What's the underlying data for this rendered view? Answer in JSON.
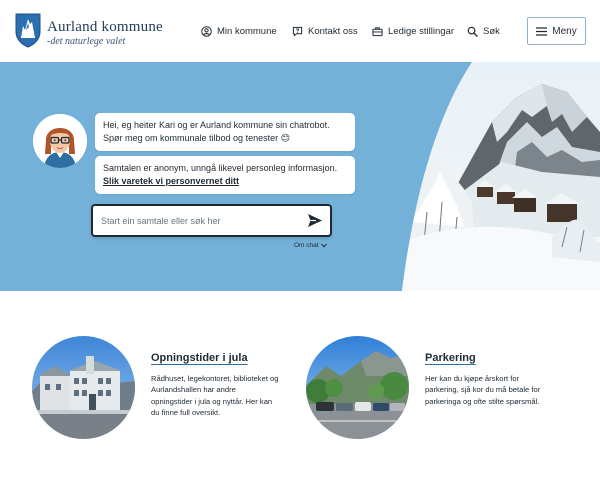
{
  "header": {
    "brand_title": "Aurland kommune",
    "brand_tagline": "-det naturlege valet",
    "nav": [
      {
        "label": "Min kommune",
        "icon": "user-circle-icon"
      },
      {
        "label": "Kontakt oss",
        "icon": "chat-question-icon"
      },
      {
        "label": "Ledige stillingar",
        "icon": "briefcase-icon"
      },
      {
        "label": "Søk",
        "icon": "search-icon"
      }
    ],
    "menu_label": "Meny"
  },
  "hero": {
    "bubble_intro": "Hei, eg heiter Kari og er Aurland kommune sin chatrobot. Spør meg om kommunale tilbod og tenester 😊",
    "bubble_privacy_text": "Samtalen er anonym, unngå likevel personleg informasjon.",
    "bubble_privacy_link": "Slik varetek vi personvernet ditt",
    "chat_placeholder": "Start ein samtale eller søk her",
    "about_chat": "Om chat"
  },
  "cards": [
    {
      "title": "Opningstider i jula",
      "text": "Rådhuset, legekontoret, biblioteket og Aurlandshallen har andre opningstider i jula og nyttår. Her kan du finne full oversikt."
    },
    {
      "title": "Parkering",
      "text": "Her kan du kjøpe årskort for parkering, sjå kor du må betale for parkeringa og ofte stilte spørsmål."
    }
  ],
  "colors": {
    "hero_bg": "#73b1d9",
    "text": "#1f2a33",
    "brand": "#23405e",
    "accent_border": "#8fb4d0"
  }
}
